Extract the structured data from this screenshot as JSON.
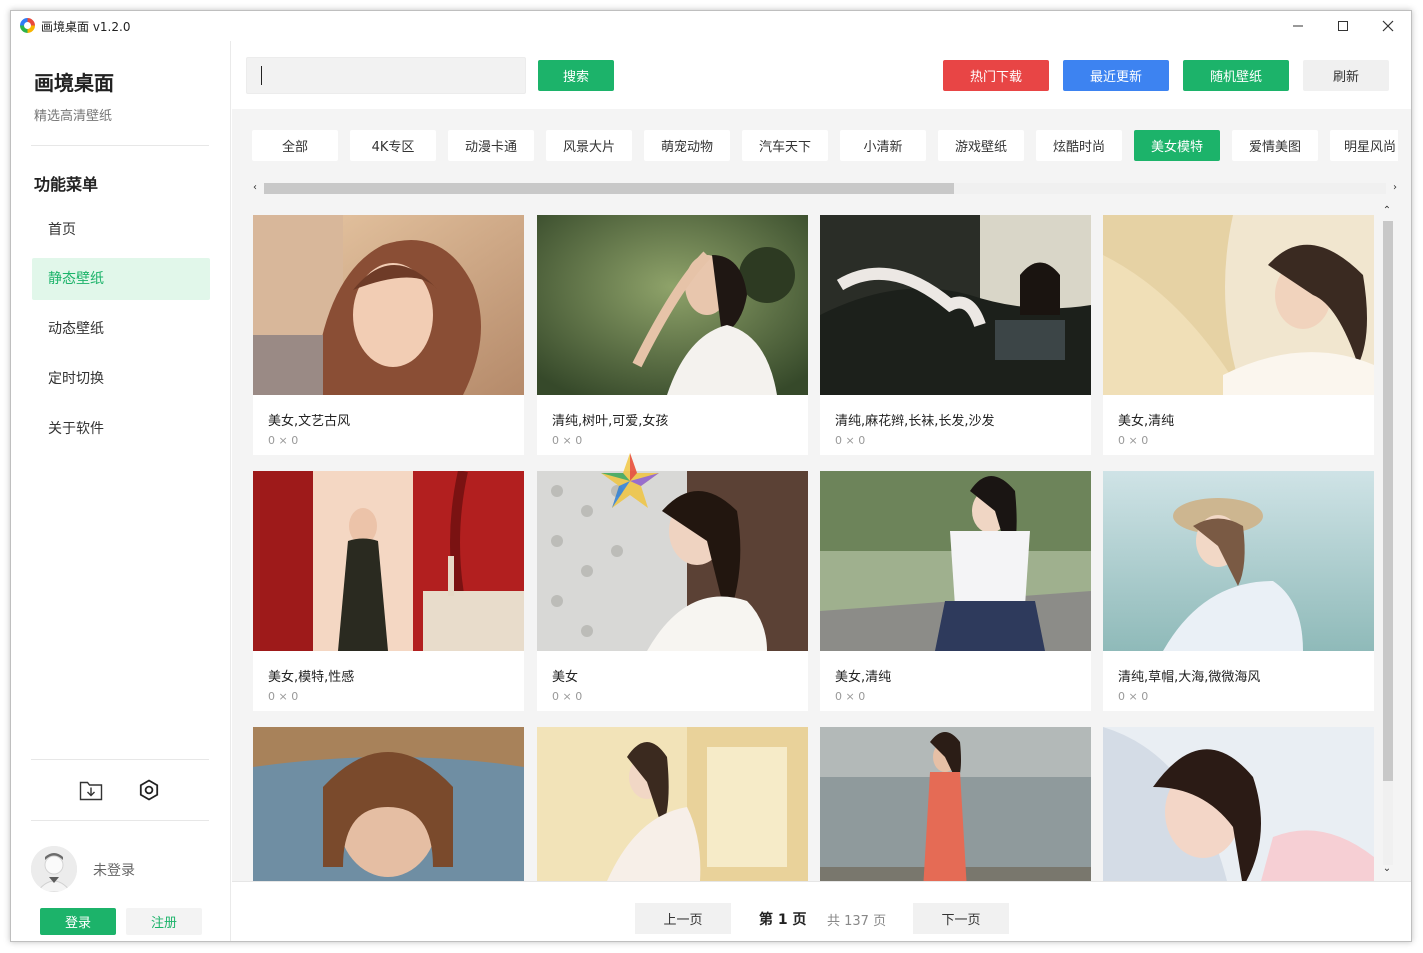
{
  "window": {
    "title": "画境桌面 v1.2.0",
    "min_icon": "minimize-icon",
    "max_icon": "maximize-icon",
    "close_icon": "close-icon"
  },
  "sidebar": {
    "app_name": "画境桌面",
    "app_tagline": "精选高清壁纸",
    "menu_heading": "功能菜单",
    "items": [
      {
        "label": "首页",
        "active": false
      },
      {
        "label": "静态壁纸",
        "active": true
      },
      {
        "label": "动态壁纸",
        "active": false
      },
      {
        "label": "定时切换",
        "active": false
      },
      {
        "label": "关于软件",
        "active": false
      }
    ],
    "tools": [
      "download-folder-icon",
      "settings-icon"
    ],
    "user_status": "未登录",
    "login_label": "登录",
    "register_label": "注册"
  },
  "topbar": {
    "search_placeholder": "",
    "search_value": "",
    "search_label": "搜索",
    "hot_label": "热门下载",
    "recent_label": "最近更新",
    "random_label": "随机壁纸",
    "refresh_label": "刷新"
  },
  "categories": [
    "全部",
    "4K专区",
    "动漫卡通",
    "风景大片",
    "萌宠动物",
    "汽车天下",
    "小清新",
    "游戏壁纸",
    "炫酷时尚",
    "美女模特",
    "爱情美图",
    "明星风尚"
  ],
  "active_category": "美女模特",
  "wallpapers": [
    {
      "caption": "美女,文艺古风",
      "dims": "0 × 0"
    },
    {
      "caption": "清纯,树叶,可爱,女孩",
      "dims": "0 × 0"
    },
    {
      "caption": "清纯,麻花辫,长袜,长发,沙发",
      "dims": "0 × 0"
    },
    {
      "caption": "美女,清纯",
      "dims": "0 × 0"
    },
    {
      "caption": "美女,模特,性感",
      "dims": "0 × 0"
    },
    {
      "caption": "美女",
      "dims": "0 × 0"
    },
    {
      "caption": "美女,清纯",
      "dims": "0 × 0"
    },
    {
      "caption": "清纯,草帽,大海,微微海风",
      "dims": "0 × 0"
    },
    {
      "caption": "",
      "dims": ""
    },
    {
      "caption": "",
      "dims": ""
    },
    {
      "caption": "",
      "dims": ""
    },
    {
      "caption": "",
      "dims": ""
    }
  ],
  "pagination": {
    "prev_label": "上一页",
    "current": "第 1 页",
    "total": "共 137 页",
    "next_label": "下一页"
  },
  "colors": {
    "accent": "#1cb36a",
    "hot": "#e84545",
    "recent": "#3d83f1"
  }
}
